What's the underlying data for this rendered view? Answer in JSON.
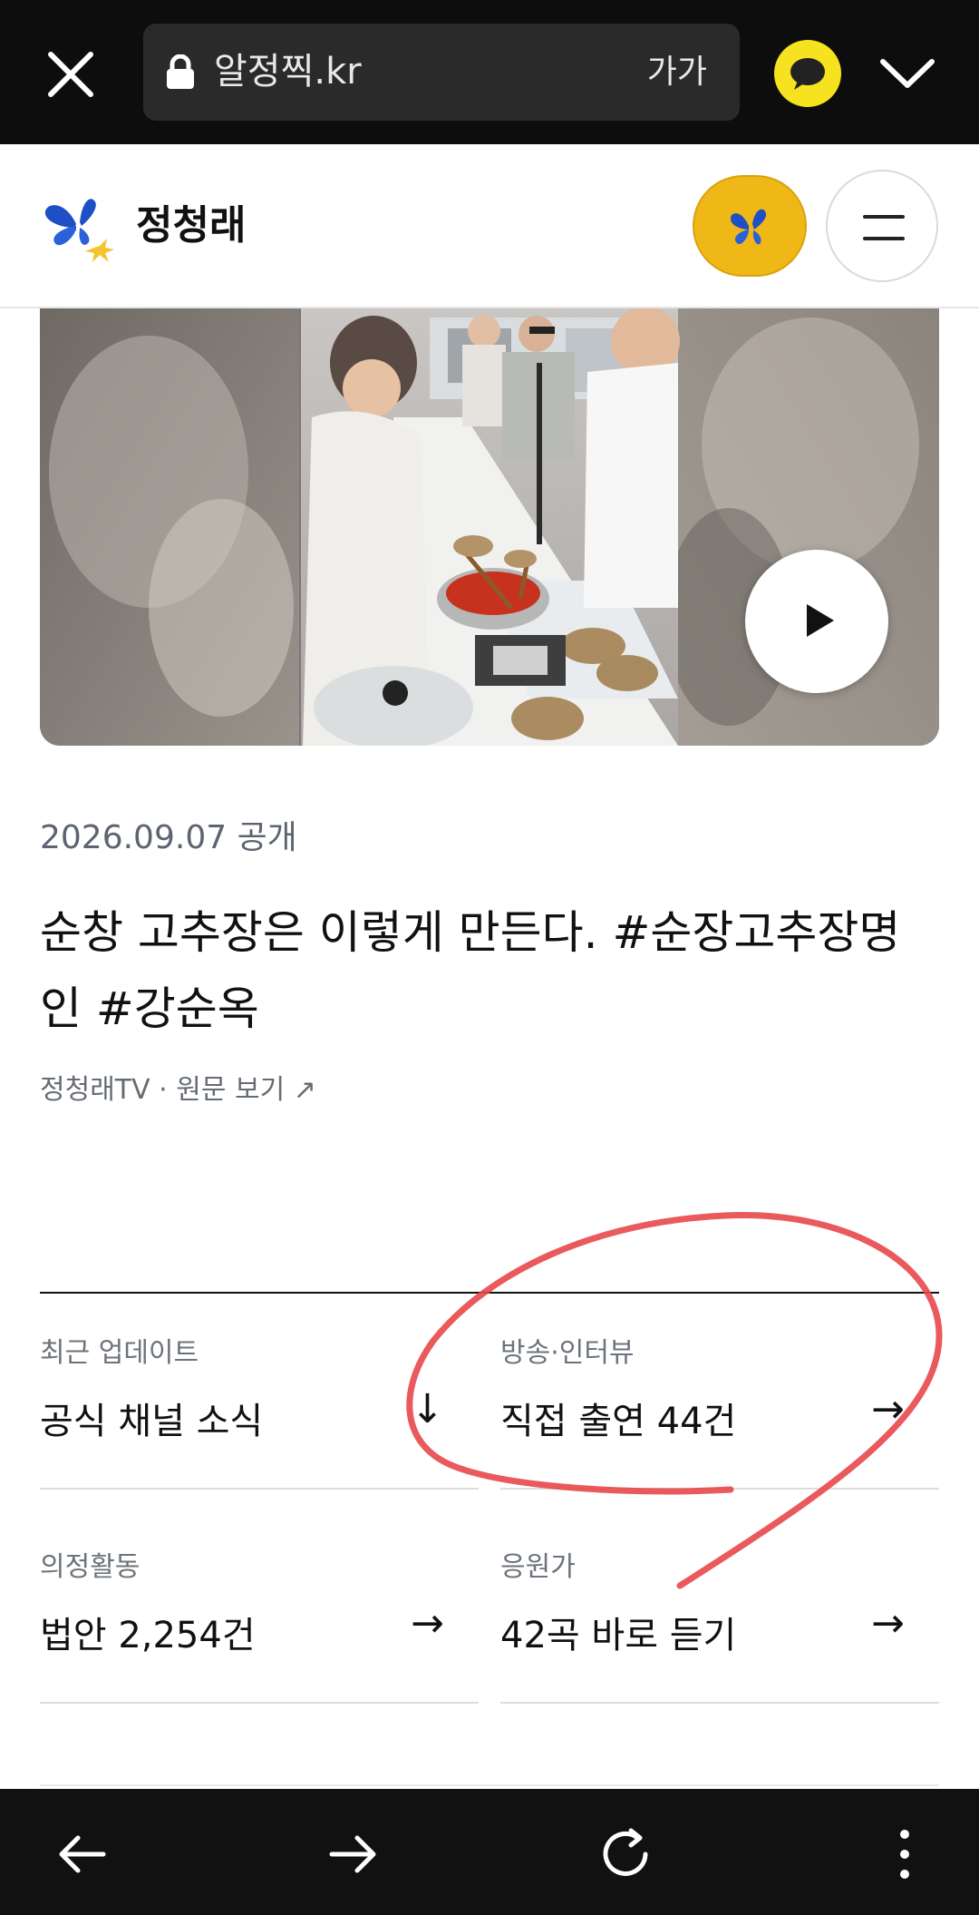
{
  "browser": {
    "url": "알정찍.kr",
    "text_size_label": "가가",
    "icons": [
      "close-icon",
      "lock-icon",
      "kakao-talk-icon",
      "chevron-down-icon"
    ]
  },
  "site": {
    "title": "정청래",
    "brand_color": "#f0b817",
    "icons": [
      "butterfly-logo-icon",
      "butterfly-icon",
      "hamburger-menu-icon"
    ]
  },
  "video": {
    "icons": [
      "play-icon"
    ]
  },
  "article": {
    "date": "2026.09.07 공개",
    "title": "순창 고추장은 이렇게 만든다. #순장고추장명인 #강순옥",
    "source": "정청래TV · 원문 보기 ↗"
  },
  "links": [
    {
      "label": "최근 업데이트",
      "value": "공식 채널 소식",
      "arrow": "↓"
    },
    {
      "label": "방송·인터뷰",
      "value": "직접 출연 44건",
      "arrow": "→"
    },
    {
      "label": "의정활동",
      "value": "법안 2,254건",
      "arrow": "→"
    },
    {
      "label": "응원가",
      "value": "42곡 바로 듣기",
      "arrow": "→"
    }
  ],
  "annotation": {
    "color": "#e8474a"
  },
  "bottom_nav": {
    "icons": [
      "back-arrow-icon",
      "forward-arrow-icon",
      "reload-icon",
      "more-vertical-icon"
    ]
  }
}
